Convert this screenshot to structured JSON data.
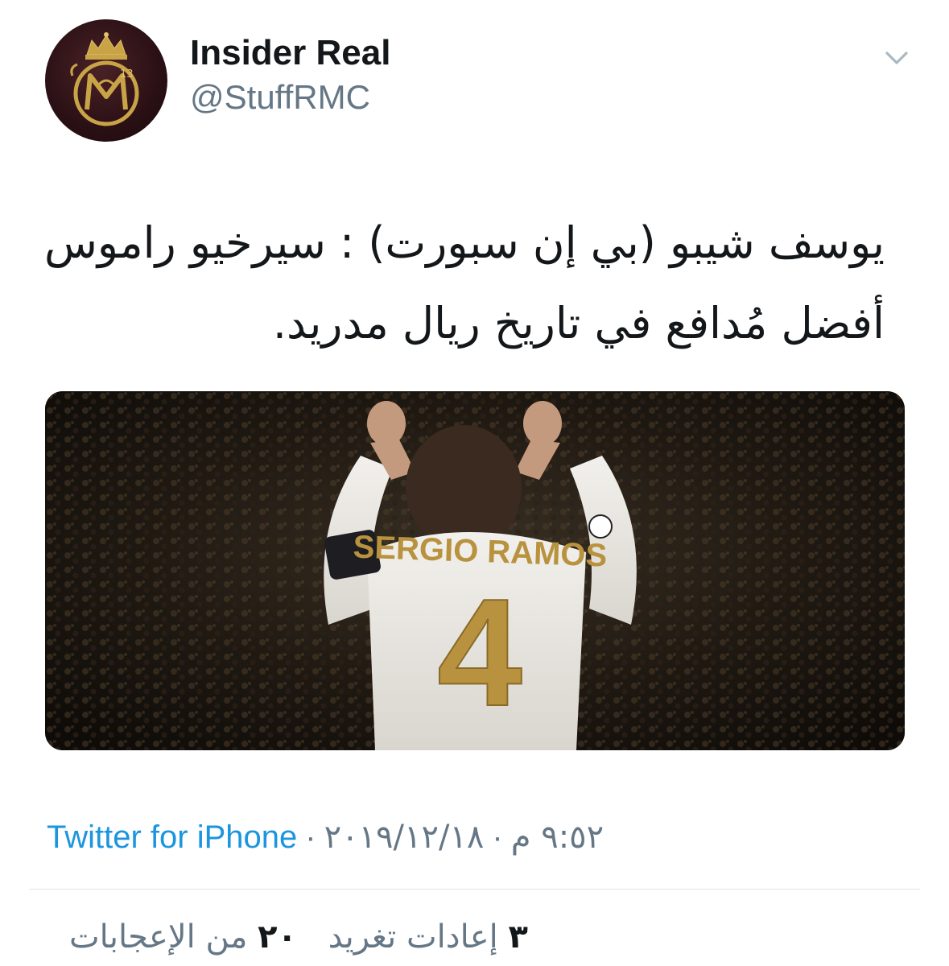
{
  "author": {
    "display_name": "Insider Real",
    "handle": "@StuffRMC",
    "avatar_icon": "real-madrid-crest-icon",
    "avatar_badge": "13"
  },
  "menu": {
    "icon": "chevron-down-icon"
  },
  "tweet": {
    "line1": "يوسف شيبو (بي إن سبورت) : سيرخيو راموس",
    "line2": "أفضل مُدافع في تاريخ ريال مدريد."
  },
  "media": {
    "jersey_name": "SERGIO RAMOS",
    "jersey_number": "4"
  },
  "meta": {
    "source": "Twitter for iPhone",
    "separator": "·",
    "date": "٢٠١٩/١٢/١٨",
    "time": "٩:٥٢ م"
  },
  "stats": {
    "retweets_count": "٣",
    "retweets_label": "إعادات تغريد",
    "likes_count": "٢٠",
    "likes_label": "من الإعجابات"
  },
  "colors": {
    "link": "#1b95e0",
    "secondary_text": "#657786",
    "primary_text": "#14171a",
    "divider": "#dfe3e6"
  }
}
